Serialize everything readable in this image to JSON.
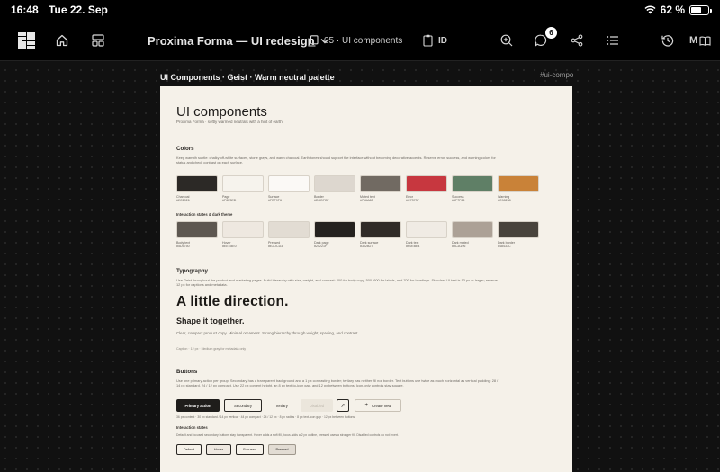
{
  "status_bar": {
    "time": "16:48",
    "date": "Tue 22. Sep",
    "battery": "62 %",
    "battery_level": 0.62
  },
  "toolbar": {
    "project_title": "Proxima Forma — UI redesign",
    "page_label": "05 · UI components",
    "clipboard_label": "ID",
    "comments_count": "6",
    "mode_label": "M"
  },
  "artboard": {
    "label": "UI Components · Geist · Warm neutral palette",
    "tag": "#ui-compo",
    "title": "UI components",
    "subtitle": "Proxima Forma · softly warmed neutrals with a hint of earth",
    "colors": {
      "heading": "Colors",
      "description": "Keep warmth subtle: chalky off-white surfaces, stone grays, and warm charcoal. Earth tones should support the interface without becoming decorative accents. Reserve error, success, and warning colors for status and check contrast on each surface.",
      "row1": [
        {
          "name": "Charcoal",
          "hex": "#2C2926",
          "color": "#2c2926"
        },
        {
          "name": "Page",
          "hex": "#F6F3ED",
          "color": "#f6f3ed"
        },
        {
          "name": "Surface",
          "hex": "#FBF9F6",
          "color": "#fbf9f6"
        },
        {
          "name": "Border",
          "hex": "#DDD7CF",
          "color": "#ddd7cf"
        },
        {
          "name": "Muted text",
          "hex": "#716A62",
          "color": "#716a62"
        },
        {
          "name": "Error",
          "hex": "#C7373F",
          "color": "#c7373f"
        },
        {
          "name": "Success",
          "hex": "#5F7F66",
          "color": "#5f7f66"
        },
        {
          "name": "Warning",
          "hex": "#C98238",
          "color": "#c98238"
        }
      ],
      "states_heading": "Interaction states & dark theme",
      "row2": [
        {
          "name": "Body text",
          "hex": "#5D5750",
          "color": "#5d5750"
        },
        {
          "name": "Hover",
          "hex": "#EEE8E0",
          "color": "#eee8e0"
        },
        {
          "name": "Pressed",
          "hex": "#E2DCD3",
          "color": "#e2dcd3"
        },
        {
          "name": "Dark page",
          "hex": "#25221F",
          "color": "#25221f"
        },
        {
          "name": "Dark surface",
          "hex": "#302B27",
          "color": "#302b27"
        },
        {
          "name": "Dark text",
          "hex": "#F0EBE4",
          "color": "#f0ebe4"
        },
        {
          "name": "Dark muted",
          "hex": "#ACA196",
          "color": "#aca196"
        },
        {
          "name": "Dark border",
          "hex": "#48433C",
          "color": "#48433c"
        }
      ]
    },
    "typography": {
      "heading": "Typography",
      "description": "Use Geist throughout the product and marketing pages. Build hierarchy with size, weight, and contrast: 400 for body copy, 500–600 for labels, and 700 for headings. Standard UI text is 13 px or larger; reserve 12 px for captions and metadata.",
      "display": "A little direction.",
      "heading_sample": "Shape it together.",
      "body_sample": "Clear, compact product copy. Minimal ornament. Strong hierarchy through weight, spacing, and contrast.",
      "caption_sample": "Caption · 12 px · Medium gray for metadata only"
    },
    "buttons": {
      "heading": "Buttons",
      "description": "Use one primary action per group. Secondary has a transparent background and a 1 px contrasting border; tertiary has neither fill nor border. Text buttons use twice as much horizontal as vertical padding: 28 / 14 px standard, 24 / 12 px compact. Use 22 px content height, an 8 px text-to-icon gap, and 12 px between buttons. Icon-only controls stay square.",
      "primary": "Primary action",
      "secondary": "Secondary",
      "tertiary": "Tertiary",
      "disabled": "Disabled",
      "icon_glyph": "↗",
      "create": "Create new",
      "create_glyph": "+",
      "spec": "36 px content · 30 px standard / 14 px vertical · 44 px compact · 24 / 12 px · 8 px radius · 8 px text-icon gap · 12 px between buttons",
      "states_heading": "Interaction states",
      "states_description": "Default and focused secondary buttons stay transparent. Hover adds a soft fill, focus adds a 2 px outline, pressed uses a stronger fill. Disabled controls do not invert.",
      "states": [
        "Default",
        "Hover",
        "Focused",
        "Pressed"
      ]
    }
  }
}
